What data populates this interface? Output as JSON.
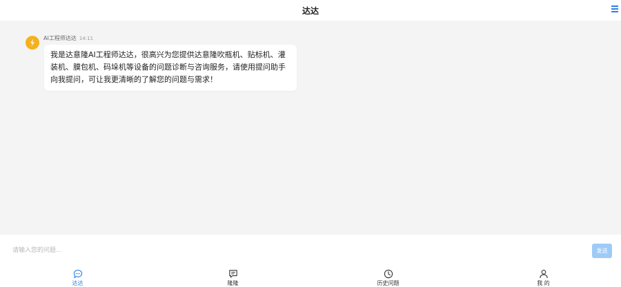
{
  "header": {
    "title": "达达",
    "menu_icon": "hamburger-menu-icon"
  },
  "chat": {
    "messages": [
      {
        "sender": "AI工程师达达",
        "time": "14:11",
        "avatar_icon": "lightning-logo-icon",
        "text": "我是达意隆AI工程师达达，很高兴为您提供达意隆吹瓶机、贴标机、灌装机、膜包机、码垛机等设备的问题诊断与咨询服务，请使用提问助手向我提问，可让我更清晰的了解您的问题与需求！"
      }
    ]
  },
  "input": {
    "placeholder": "请输入您的问题...",
    "send_label": "发送"
  },
  "tabs": [
    {
      "label": "达达",
      "icon": "chat-bubble-icon",
      "active": true
    },
    {
      "label": "隆隆",
      "icon": "message-box-icon",
      "active": false
    },
    {
      "label": "历史问题",
      "icon": "clock-icon",
      "active": false
    },
    {
      "label": "我 的",
      "icon": "user-icon",
      "active": false
    }
  ],
  "colors": {
    "accent": "#2b7de9",
    "send_button": "#9ecbf6",
    "avatar": "#f3b21d",
    "background": "#f4f4f4"
  }
}
